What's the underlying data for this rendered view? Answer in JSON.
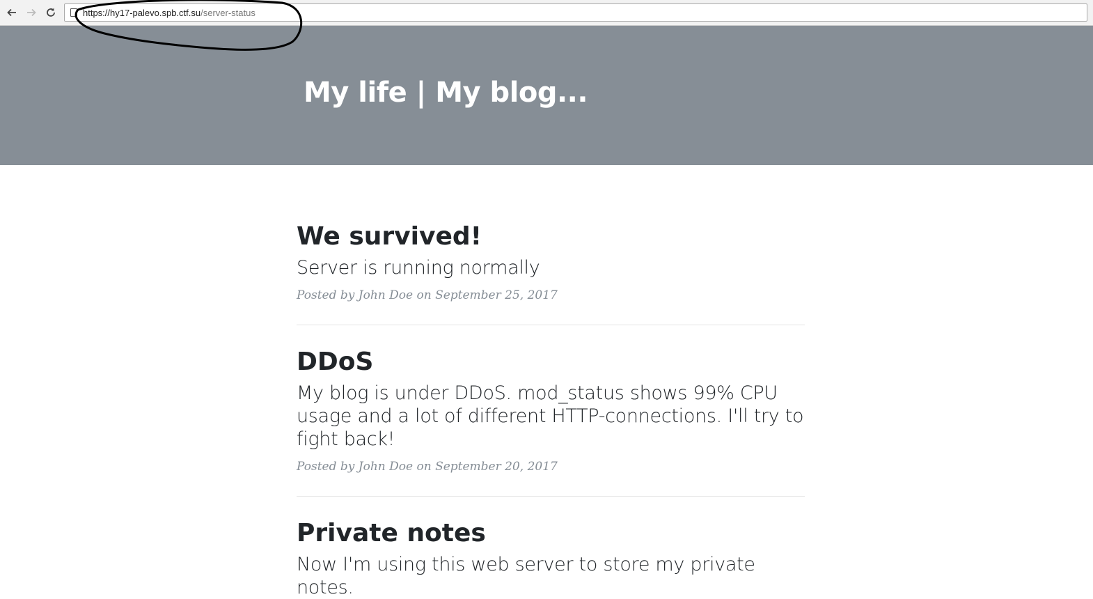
{
  "browser": {
    "url_host": "https://hy17-palevo.spb.ctf.su",
    "url_path": "/server-status"
  },
  "site": {
    "title": "My life | My blog..."
  },
  "posts": [
    {
      "title": "We survived!",
      "subtitle": "Server is running normally",
      "meta_prefix": "Posted by",
      "author": "John Doe",
      "meta_on": "on",
      "date": "September 25, 2017"
    },
    {
      "title": "DDoS",
      "subtitle": "My blog is under DDoS. mod_status shows 99% CPU usage and a lot of different HTTP-connections. I'll try to fight back!",
      "meta_prefix": "Posted by",
      "author": "John Doe",
      "meta_on": "on",
      "date": "September 20, 2017"
    },
    {
      "title": "Private notes",
      "subtitle": "Now I'm using this web server to store my private notes."
    }
  ],
  "icons": {
    "back": "arrow-left-icon",
    "forward": "arrow-right-icon",
    "reload": "reload-icon",
    "page": "page-icon"
  }
}
